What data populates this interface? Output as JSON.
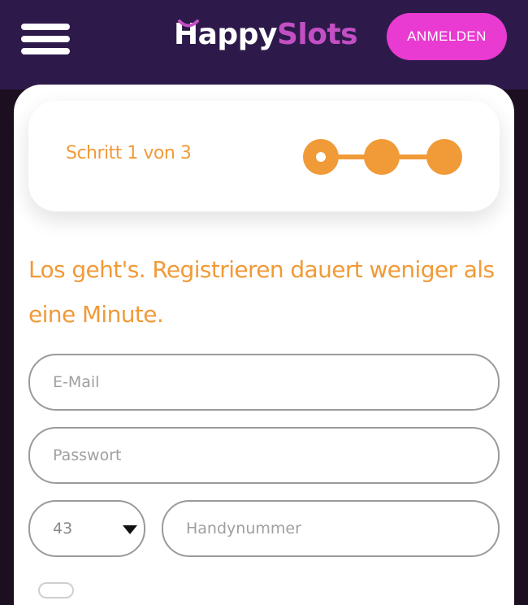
{
  "header": {
    "logo_first": "Happy",
    "logo_second": "Slots",
    "login_label": "ANMELDEN",
    "menu_icon": "hamburger-menu-icon",
    "colors": {
      "header_bg": "#2d1a4a",
      "login_bg": "#e93ad1",
      "logo_accent": "#c34fc4"
    }
  },
  "stepper": {
    "label": "Schritt 1 von 3",
    "current_step": 1,
    "total_steps": 3,
    "color": "#f19a38"
  },
  "form": {
    "headline": "Los geht's. Registrieren dauert weniger als eine Minute.",
    "email_placeholder": "E-Mail",
    "password_placeholder": "Passwort",
    "country_code": "43",
    "phone_placeholder": "Handynummer"
  }
}
